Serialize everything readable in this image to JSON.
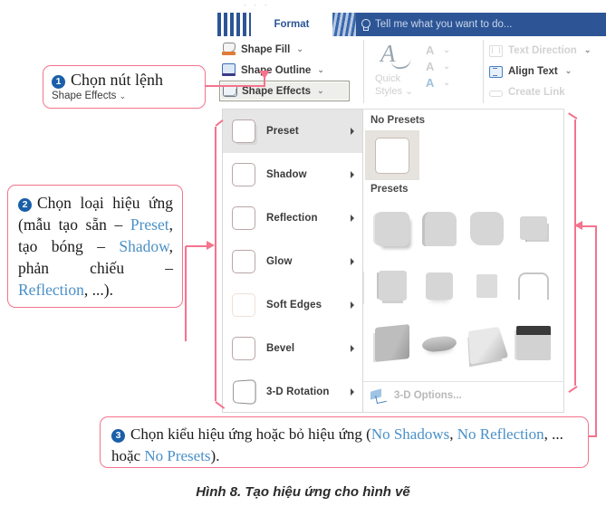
{
  "top_sliver": "· · ·",
  "ribbon": {
    "tab_label": "Format",
    "tellme_placeholder": "Tell me what you want to do...",
    "bulb_icon": "lightbulb-icon",
    "shape_group": {
      "fill_label": "Shape Fill",
      "fill_icon": "shape-fill-icon",
      "outline_label": "Shape Outline",
      "outline_icon": "shape-outline-icon",
      "effects_label": "Shape Effects",
      "effects_icon": "shape-effects-icon",
      "caret": "⌄"
    },
    "quick_styles": {
      "glyph": "A",
      "line1": "Quick",
      "line2": "Styles",
      "items": [
        "A",
        "A",
        "A"
      ],
      "caret": "⌄"
    },
    "text_group": {
      "direction_label": "Text Direction",
      "direction_icon": "text-direction-icon",
      "align_label": "Align Text",
      "align_icon": "align-text-icon",
      "link_label": "Create Link",
      "link_icon": "create-link-icon",
      "caret": "⌄"
    }
  },
  "menu": {
    "items": [
      {
        "label": "Preset",
        "icon": "preset-icon",
        "selected": true,
        "has_submenu": true
      },
      {
        "label": "Shadow",
        "icon": "shadow-icon",
        "selected": false,
        "has_submenu": true
      },
      {
        "label": "Reflection",
        "icon": "reflection-icon",
        "selected": false,
        "has_submenu": true
      },
      {
        "label": "Glow",
        "icon": "glow-icon",
        "selected": false,
        "has_submenu": true
      },
      {
        "label": "Soft Edges",
        "icon": "soft-edges-icon",
        "selected": false,
        "has_submenu": true
      },
      {
        "label": "Bevel",
        "icon": "bevel-icon",
        "selected": false,
        "has_submenu": true
      },
      {
        "label": "3-D Rotation",
        "icon": "3d-rotation-icon",
        "selected": false,
        "has_submenu": true
      }
    ]
  },
  "submenu": {
    "no_presets_label": "No Presets",
    "presets_label": "Presets",
    "options_label": "3-D Options...",
    "options_icon": "3d-options-icon",
    "preset_count": 12
  },
  "callouts": {
    "one": {
      "number": "1",
      "text": "Chọn nút lệnh",
      "sub": "Shape Effects",
      "sub_caret": "⌄"
    },
    "two": {
      "number": "2",
      "segments": [
        {
          "t": "Chọn loại hiệu ứng (mẫu tạo sẵn – ",
          "k": false
        },
        {
          "t": "Preset",
          "k": true
        },
        {
          "t": ", tạo bóng – ",
          "k": false
        },
        {
          "t": "Shadow",
          "k": true
        },
        {
          "t": ", phản chiếu – ",
          "k": false
        },
        {
          "t": "Reflection",
          "k": true
        },
        {
          "t": ", ...).",
          "k": false
        }
      ]
    },
    "three": {
      "number": "3",
      "segments": [
        {
          "t": "Chọn kiểu hiệu ứng hoặc bỏ hiệu ứng (",
          "k": false
        },
        {
          "t": "No Shadows",
          "k": true
        },
        {
          "t": ", ",
          "k": false
        },
        {
          "t": "No Reflection",
          "k": true
        },
        {
          "t": ", ... hoặc ",
          "k": false
        },
        {
          "t": "No Presets",
          "k": true
        },
        {
          "t": ").",
          "k": false
        }
      ]
    }
  },
  "caption": "Hình 8. Tạo hiệu ứng cho hình vẽ",
  "colors": {
    "annotation_red": "#f4738d",
    "keyword_blue": "#4a90c8",
    "badge_blue": "#1a5fa8",
    "ribbon_blue": "#2d5596"
  }
}
